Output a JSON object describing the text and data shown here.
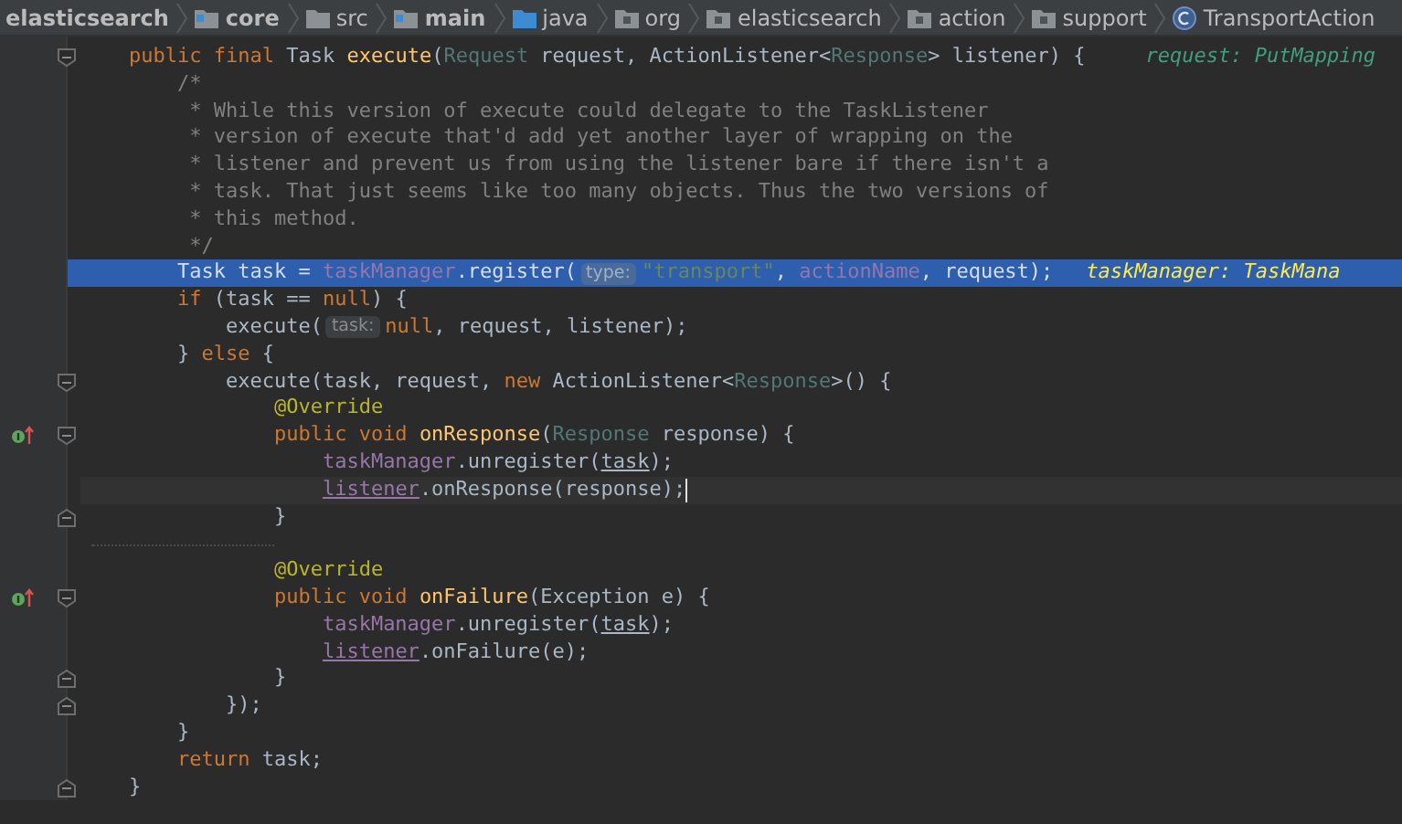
{
  "breadcrumbs": [
    {
      "kind": "project",
      "label": "elasticsearch"
    },
    {
      "kind": "module",
      "label": "core"
    },
    {
      "kind": "folder",
      "label": "src"
    },
    {
      "kind": "source_root",
      "label": "main"
    },
    {
      "kind": "source_folder",
      "label": "java"
    },
    {
      "kind": "package",
      "label": "org"
    },
    {
      "kind": "package",
      "label": "elasticsearch"
    },
    {
      "kind": "package",
      "label": "action"
    },
    {
      "kind": "package",
      "label": "support"
    },
    {
      "kind": "class",
      "label": "TransportAction"
    }
  ],
  "lines": [
    {
      "highlighted": false,
      "current": false,
      "fold_start": true,
      "fold_end": false,
      "override": false,
      "tokens": [
        {
          "kind": "kw",
          "text": "    public final "
        },
        {
          "kind": "plain",
          "text": "Task "
        },
        {
          "kind": "decl",
          "text": "execute"
        },
        {
          "kind": "plain",
          "text": "("
        },
        {
          "kind": "ptype",
          "text": "Request"
        },
        {
          "kind": "plain",
          "text": " request, ActionListener<"
        },
        {
          "kind": "ptype",
          "text": "Response"
        },
        {
          "kind": "plain",
          "text": "> listener) {"
        },
        {
          "kind": "hint",
          "text": "request: PutMapping"
        }
      ]
    },
    {
      "highlighted": false,
      "current": false,
      "fold_start": false,
      "fold_end": false,
      "override": false,
      "tokens": [
        {
          "kind": "comment",
          "text": "        /*"
        }
      ]
    },
    {
      "highlighted": false,
      "current": false,
      "fold_start": false,
      "fold_end": false,
      "override": false,
      "tokens": [
        {
          "kind": "comment",
          "text": "         * While this version of execute could delegate to the TaskListener"
        }
      ]
    },
    {
      "highlighted": false,
      "current": false,
      "fold_start": false,
      "fold_end": false,
      "override": false,
      "tokens": [
        {
          "kind": "comment",
          "text": "         * version of execute that'd add yet another layer of wrapping on the"
        }
      ]
    },
    {
      "highlighted": false,
      "current": false,
      "fold_start": false,
      "fold_end": false,
      "override": false,
      "tokens": [
        {
          "kind": "comment",
          "text": "         * listener and prevent us from using the listener bare if there isn't a"
        }
      ]
    },
    {
      "highlighted": false,
      "current": false,
      "fold_start": false,
      "fold_end": false,
      "override": false,
      "tokens": [
        {
          "kind": "comment",
          "text": "         * task. That just seems like too many objects. Thus the two versions of"
        }
      ]
    },
    {
      "highlighted": false,
      "current": false,
      "fold_start": false,
      "fold_end": false,
      "override": false,
      "tokens": [
        {
          "kind": "comment",
          "text": "         * this method."
        }
      ]
    },
    {
      "highlighted": false,
      "current": false,
      "fold_start": false,
      "fold_end": false,
      "override": false,
      "tokens": [
        {
          "kind": "comment",
          "text": "         */"
        }
      ]
    },
    {
      "highlighted": true,
      "current": false,
      "fold_start": false,
      "fold_end": false,
      "override": false,
      "tokens": [
        {
          "kind": "plain",
          "text": "        Task task = "
        },
        {
          "kind": "field",
          "text": "taskManager"
        },
        {
          "kind": "plain",
          "text": ".register("
        },
        {
          "kind": "inlay",
          "text": "type:"
        },
        {
          "kind": "str",
          "text": "\"transport\""
        },
        {
          "kind": "plain",
          "text": ", "
        },
        {
          "kind": "field",
          "text": "actionName"
        },
        {
          "kind": "plain",
          "text": ", request);"
        },
        {
          "kind": "hint",
          "text": "taskManager: TaskMana"
        }
      ]
    },
    {
      "highlighted": false,
      "current": false,
      "fold_start": false,
      "fold_end": false,
      "override": false,
      "tokens": [
        {
          "kind": "kw",
          "text": "        if "
        },
        {
          "kind": "plain",
          "text": "(task == "
        },
        {
          "kind": "kw",
          "text": "null"
        },
        {
          "kind": "plain",
          "text": ") {"
        }
      ]
    },
    {
      "highlighted": false,
      "current": false,
      "fold_start": false,
      "fold_end": false,
      "override": false,
      "tokens": [
        {
          "kind": "plain",
          "text": "            execute("
        },
        {
          "kind": "inlay",
          "text": "task:"
        },
        {
          "kind": "kw",
          "text": "null"
        },
        {
          "kind": "plain",
          "text": ", request, listener);"
        }
      ]
    },
    {
      "highlighted": false,
      "current": false,
      "fold_start": false,
      "fold_end": false,
      "override": false,
      "tokens": [
        {
          "kind": "plain",
          "text": "        } "
        },
        {
          "kind": "kw",
          "text": "else "
        },
        {
          "kind": "plain",
          "text": "{"
        }
      ]
    },
    {
      "highlighted": false,
      "current": false,
      "fold_start": true,
      "fold_end": false,
      "override": false,
      "tokens": [
        {
          "kind": "plain",
          "text": "            execute(task, request, "
        },
        {
          "kind": "kw",
          "text": "new "
        },
        {
          "kind": "plain",
          "text": "ActionListener<"
        },
        {
          "kind": "ptype",
          "text": "Response"
        },
        {
          "kind": "plain",
          "text": ">() {"
        }
      ]
    },
    {
      "highlighted": false,
      "current": false,
      "fold_start": false,
      "fold_end": false,
      "override": false,
      "tokens": [
        {
          "kind": "annot",
          "text": "                @Override"
        }
      ]
    },
    {
      "highlighted": false,
      "current": false,
      "fold_start": true,
      "fold_end": false,
      "override": true,
      "tokens": [
        {
          "kind": "kw",
          "text": "                public void "
        },
        {
          "kind": "decl",
          "text": "onResponse"
        },
        {
          "kind": "plain",
          "text": "("
        },
        {
          "kind": "ptype",
          "text": "Response"
        },
        {
          "kind": "plain",
          "text": " response) {"
        }
      ]
    },
    {
      "highlighted": false,
      "current": false,
      "fold_start": false,
      "fold_end": false,
      "override": false,
      "tokens": [
        {
          "kind": "field",
          "text": "                    taskManager"
        },
        {
          "kind": "plain",
          "text": ".unregister("
        },
        {
          "kind": "ulvar",
          "text": "task"
        },
        {
          "kind": "plain",
          "text": ");"
        }
      ]
    },
    {
      "highlighted": false,
      "current": true,
      "fold_start": false,
      "fold_end": false,
      "override": false,
      "tokens": [
        {
          "kind": "ulfield",
          "text": "                    listener"
        },
        {
          "kind": "plain",
          "text": ".onResponse(response);"
        }
      ]
    },
    {
      "highlighted": false,
      "current": false,
      "fold_start": false,
      "fold_end": true,
      "override": false,
      "tokens": [
        {
          "kind": "plain",
          "text": "                }"
        }
      ]
    },
    {
      "highlighted": false,
      "current": false,
      "fold_start": false,
      "fold_end": false,
      "override": false
    },
    {
      "highlighted": false,
      "current": false,
      "fold_start": false,
      "fold_end": false,
      "override": false,
      "tokens": [
        {
          "kind": "annot",
          "text": "                @Override"
        }
      ]
    },
    {
      "highlighted": false,
      "current": false,
      "fold_start": true,
      "fold_end": false,
      "override": true,
      "tokens": [
        {
          "kind": "kw",
          "text": "                public void "
        },
        {
          "kind": "decl",
          "text": "onFailure"
        },
        {
          "kind": "plain",
          "text": "(Exception e) {"
        }
      ]
    },
    {
      "highlighted": false,
      "current": false,
      "fold_start": false,
      "fold_end": false,
      "override": false,
      "tokens": [
        {
          "kind": "field",
          "text": "                    taskManager"
        },
        {
          "kind": "plain",
          "text": ".unregister("
        },
        {
          "kind": "ulvar",
          "text": "task"
        },
        {
          "kind": "plain",
          "text": ");"
        }
      ]
    },
    {
      "highlighted": false,
      "current": false,
      "fold_start": false,
      "fold_end": false,
      "override": false,
      "tokens": [
        {
          "kind": "ulfield",
          "text": "                    listener"
        },
        {
          "kind": "plain",
          "text": ".onFailure(e);"
        }
      ]
    },
    {
      "highlighted": false,
      "current": false,
      "fold_start": false,
      "fold_end": true,
      "override": false,
      "tokens": [
        {
          "kind": "plain",
          "text": "                }"
        }
      ]
    },
    {
      "highlighted": false,
      "current": false,
      "fold_start": false,
      "fold_end": true,
      "override": false,
      "tokens": [
        {
          "kind": "plain",
          "text": "            });"
        }
      ]
    },
    {
      "highlighted": false,
      "current": false,
      "fold_start": false,
      "fold_end": false,
      "override": false,
      "tokens": [
        {
          "kind": "plain",
          "text": "        }"
        }
      ]
    },
    {
      "highlighted": false,
      "current": false,
      "fold_start": false,
      "fold_end": false,
      "override": false,
      "tokens": [
        {
          "kind": "kw",
          "text": "        return "
        },
        {
          "kind": "plain",
          "text": "task;"
        }
      ]
    },
    {
      "highlighted": false,
      "current": false,
      "fold_start": false,
      "fold_end": true,
      "override": false,
      "tokens": [
        {
          "kind": "plain",
          "text": "    }"
        }
      ]
    }
  ]
}
